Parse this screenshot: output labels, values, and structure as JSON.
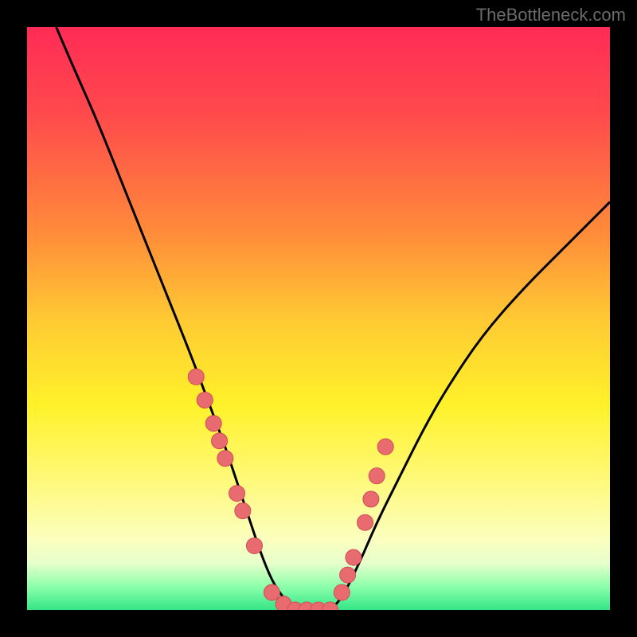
{
  "watermark": "TheBottleneck.com",
  "colors": {
    "background": "#000000",
    "curve_stroke": "#000000",
    "marker_fill": "#e86b6f",
    "marker_stroke": "#d44b55",
    "gradient_top": "#ff2b56",
    "gradient_bottom": "#35e587"
  },
  "chart_data": {
    "type": "line",
    "title": "",
    "xlabel": "",
    "ylabel": "",
    "xlim": [
      0,
      100
    ],
    "ylim": [
      0,
      100
    ],
    "series": [
      {
        "name": "bottleneck-curve",
        "x": [
          5,
          8,
          12,
          16,
          20,
          24,
          28,
          31,
          34,
          36,
          38,
          40,
          42,
          44,
          46,
          48,
          50,
          52,
          54,
          57,
          60,
          64,
          68,
          72,
          78,
          85,
          92,
          100
        ],
        "y": [
          100,
          93,
          84,
          74,
          64,
          54,
          44,
          36,
          28,
          22,
          16,
          10,
          5,
          2,
          0,
          0,
          0,
          0,
          2,
          8,
          15,
          23,
          31,
          38,
          47,
          55,
          62,
          70
        ]
      }
    ],
    "markers": {
      "name": "sample-points",
      "x": [
        29,
        30.5,
        32,
        33,
        34,
        36,
        37,
        39,
        42,
        44,
        46,
        48,
        50,
        52,
        54,
        55,
        56,
        58,
        59,
        60,
        61.5
      ],
      "y": [
        40,
        36,
        32,
        29,
        26,
        20,
        17,
        11,
        3,
        1,
        0,
        0,
        0,
        0,
        3,
        6,
        9,
        15,
        19,
        23,
        28
      ]
    }
  }
}
